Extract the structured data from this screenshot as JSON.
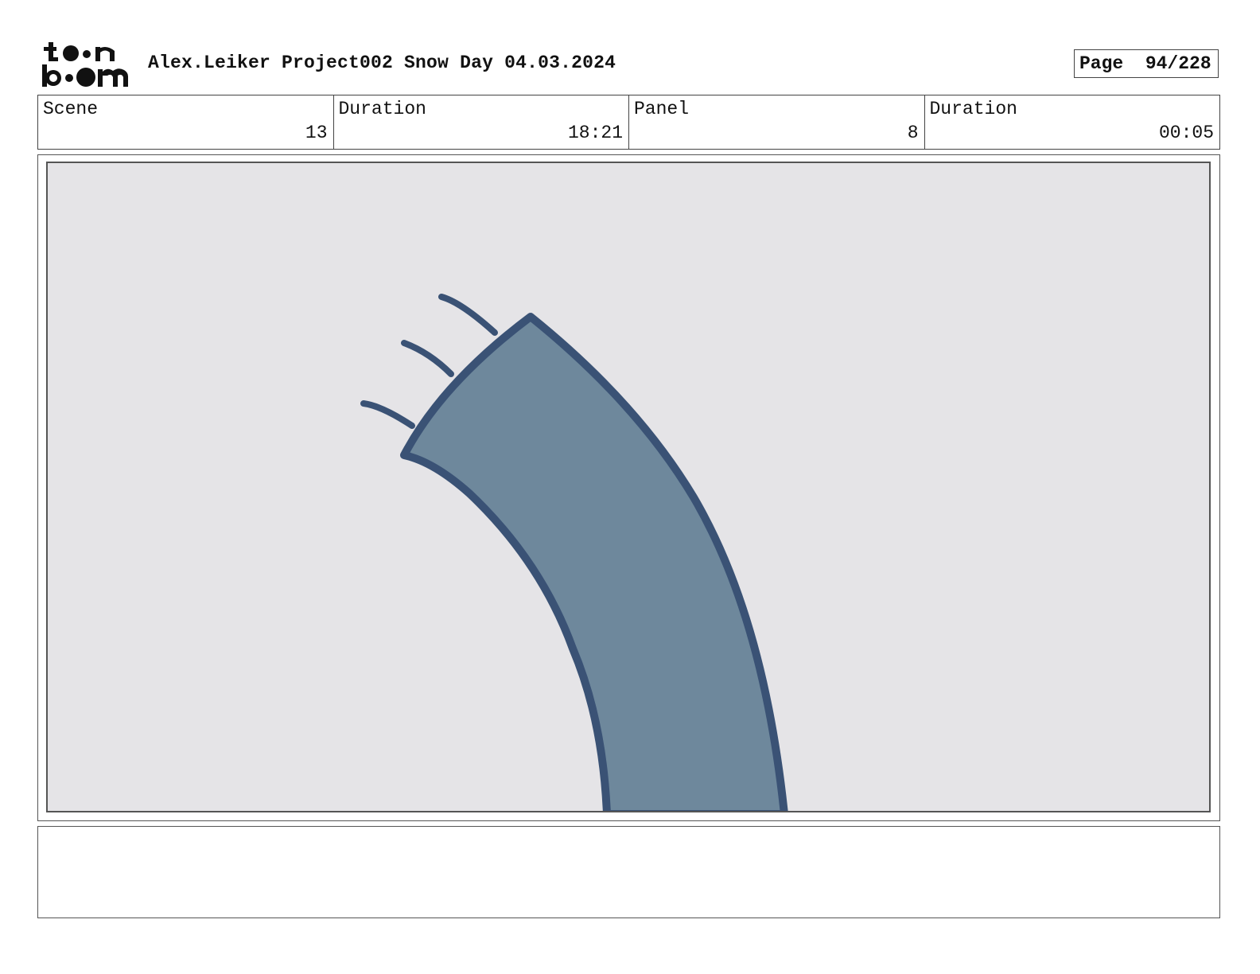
{
  "logo": {
    "line1": "toon",
    "line2": "boom"
  },
  "header": {
    "title": "Alex.Leiker Project002 Snow Day 04.03.2024",
    "page": "Page  94/228"
  },
  "info": {
    "scene_label": "Scene",
    "scene_value": "13",
    "scene_duration_label": "Duration",
    "scene_duration_value": "18:21",
    "panel_label": "Panel",
    "panel_value": "8",
    "panel_duration_label": "Duration",
    "panel_duration_value": "00:05"
  },
  "drawing": {
    "subject": "blue-arm-with-fingers-sketch",
    "fill_color": "#6e889c",
    "stroke_color": "#3a5275",
    "background_color": "#e5e4e7"
  },
  "notes": {
    "text": ""
  }
}
